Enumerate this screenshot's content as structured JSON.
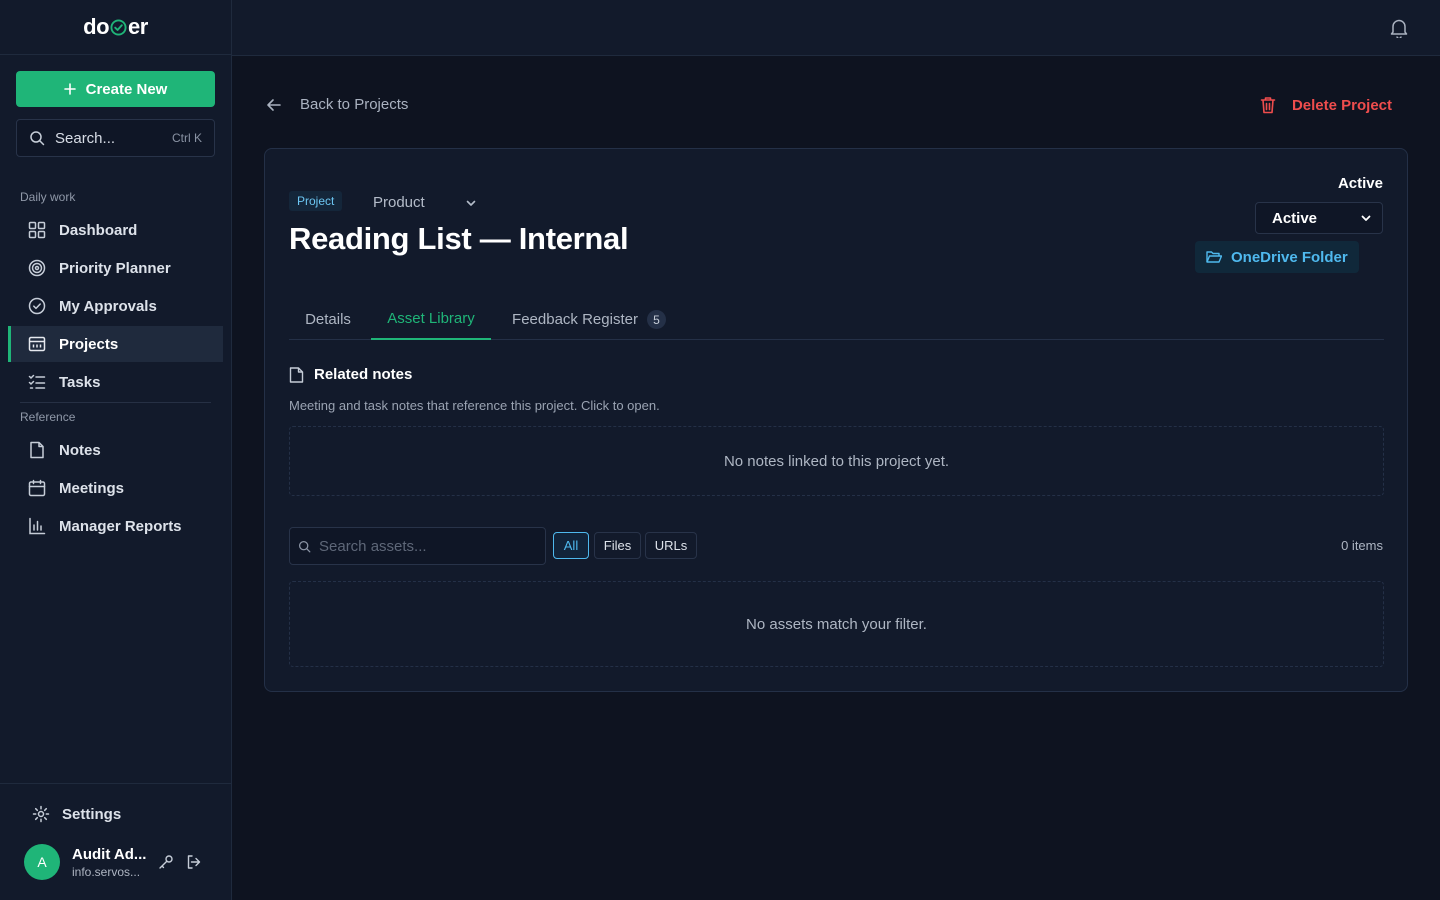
{
  "app": {
    "logo_left": "do",
    "logo_right": "er"
  },
  "sidebar": {
    "create_label": "Create New",
    "search_placeholder": "Search...",
    "search_shortcut": "Ctrl K",
    "sections": {
      "daily": "Daily work",
      "reference": "Reference"
    },
    "daily_items": [
      {
        "label": "Dashboard",
        "icon": "dashboard-icon"
      },
      {
        "label": "Priority Planner",
        "icon": "target-icon"
      },
      {
        "label": "My Approvals",
        "icon": "check-circle-icon"
      },
      {
        "label": "Projects",
        "icon": "projects-icon",
        "active": true
      },
      {
        "label": "Tasks",
        "icon": "tasks-icon"
      }
    ],
    "reference_items": [
      {
        "label": "Notes",
        "icon": "note-icon"
      },
      {
        "label": "Meetings",
        "icon": "calendar-icon"
      },
      {
        "label": "Manager Reports",
        "icon": "bar-chart-icon"
      }
    ],
    "settings_label": "Settings",
    "user": {
      "initial": "A",
      "name": "Audit Ad...",
      "email": "info.servos..."
    }
  },
  "header": {
    "back_label": "Back to Projects",
    "delete_label": "Delete Project"
  },
  "project": {
    "tag": "Project",
    "category": "Product",
    "title": "Reading List — Internal",
    "status_label": "Active",
    "status_value": "Active",
    "onedrive_label": "OneDrive Folder"
  },
  "tabs": [
    {
      "label": "Details"
    },
    {
      "label": "Asset Library",
      "active": true
    },
    {
      "label": "Feedback Register",
      "badge": "5"
    }
  ],
  "related_notes": {
    "title": "Related notes",
    "subtitle": "Meeting and task notes that reference this project. Click to open.",
    "empty": "No notes linked to this project yet."
  },
  "assets": {
    "search_placeholder": "Search assets...",
    "filters": [
      "All",
      "Files",
      "URLs"
    ],
    "active_filter": "All",
    "count": "0 items",
    "empty": "No assets match your filter."
  },
  "colors": {
    "accent": "#1fb578",
    "link": "#4fb9ee",
    "danger": "#ef4d4d",
    "background": "#0e1320",
    "panel": "#121a2b"
  }
}
